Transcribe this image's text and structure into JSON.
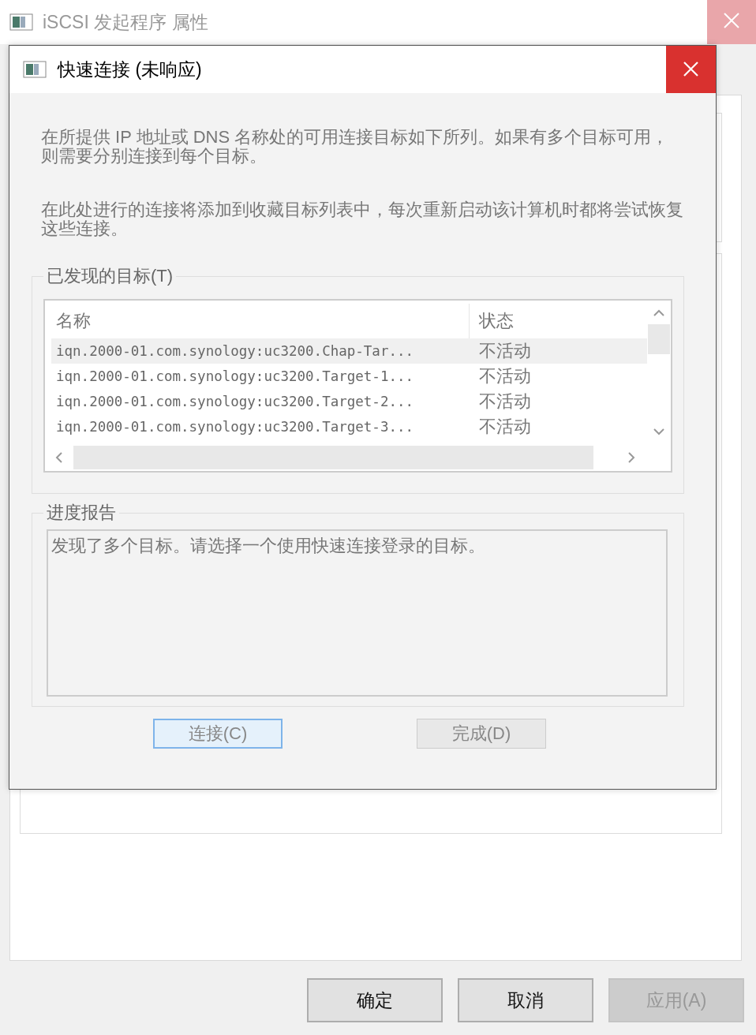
{
  "parent_window": {
    "title": "iSCSI 发起程序 属性",
    "buttons": [
      {
        "label": "确定",
        "disabled": false
      },
      {
        "label": "取消",
        "disabled": false
      },
      {
        "label": "应用(A)",
        "disabled": true
      }
    ]
  },
  "dialog": {
    "title": "快速连接 (未响应)",
    "paragraphs": [
      "在所提供 IP 地址或 DNS 名称处的可用连接目标如下所列。如果有多个目标可用，则需要分别连接到每个目标。",
      "在此处进行的连接将添加到收藏目标列表中，每次重新启动该计算机时都将尝试恢复这些连接。"
    ],
    "targets_group": {
      "label": "已发现的目标(T)",
      "columns": [
        "名称",
        "状态"
      ],
      "rows": [
        {
          "name": "iqn.2000-01.com.synology:uc3200.Chap-Tar...",
          "status": "不活动",
          "selected": true
        },
        {
          "name": "iqn.2000-01.com.synology:uc3200.Target-1...",
          "status": "不活动",
          "selected": false
        },
        {
          "name": "iqn.2000-01.com.synology:uc3200.Target-2...",
          "status": "不活动",
          "selected": false
        },
        {
          "name": "iqn.2000-01.com.synology:uc3200.Target-3...",
          "status": "不活动",
          "selected": false
        }
      ]
    },
    "progress_group": {
      "label": "进度报告",
      "text": "发现了多个目标。请选择一个使用快速连接登录的目标。"
    },
    "buttons": [
      {
        "label": "连接(C)",
        "default": true
      },
      {
        "label": "完成(D)",
        "default": false
      }
    ]
  }
}
